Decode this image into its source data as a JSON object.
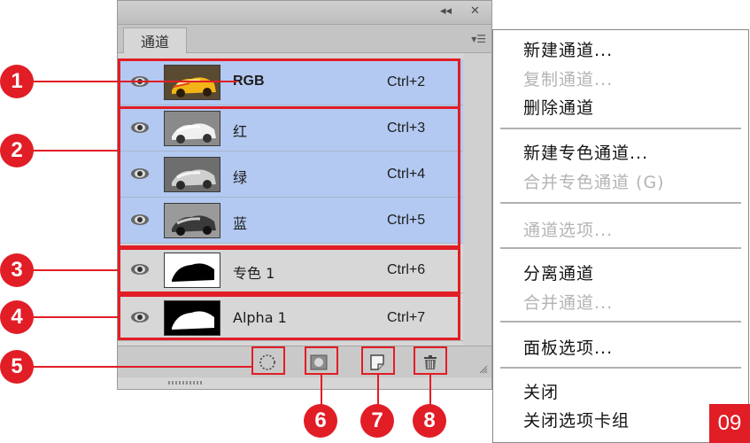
{
  "panel": {
    "titlebar": {
      "collapse_glyph": "◂◂",
      "close_glyph": "✕"
    },
    "tab_label": "通道",
    "menu_glyph": "▾☰",
    "channels": [
      {
        "name": "RGB",
        "shortcut": "Ctrl+2",
        "selected": true,
        "visible": true
      },
      {
        "name": "红",
        "shortcut": "Ctrl+3",
        "selected": true,
        "visible": true
      },
      {
        "name": "绿",
        "shortcut": "Ctrl+4",
        "selected": true,
        "visible": true
      },
      {
        "name": "蓝",
        "shortcut": "Ctrl+5",
        "selected": true,
        "visible": true
      },
      {
        "name": "专色 1",
        "shortcut": "Ctrl+6",
        "selected": false,
        "visible": true
      },
      {
        "name": "Alpha 1",
        "shortcut": "Ctrl+7",
        "selected": false,
        "visible": true
      }
    ],
    "bottom_buttons": [
      "load-channel-as-selection",
      "save-selection-as-channel",
      "create-new-channel",
      "delete-channel"
    ]
  },
  "callouts": [
    "1",
    "2",
    "3",
    "4",
    "5",
    "6",
    "7",
    "8"
  ],
  "flyout_menu": {
    "groups": [
      [
        {
          "label": "新建通道...",
          "enabled": true
        },
        {
          "label": "复制通道...",
          "enabled": false
        },
        {
          "label": "删除通道",
          "enabled": true
        }
      ],
      [
        {
          "label": "新建专色通道...",
          "enabled": true
        },
        {
          "label": "合并专色通道 (G)",
          "enabled": false
        }
      ],
      [
        {
          "label": "通道选项...",
          "enabled": false
        }
      ],
      [
        {
          "label": "分离通道",
          "enabled": true
        },
        {
          "label": "合并通道...",
          "enabled": false
        }
      ],
      [
        {
          "label": "面板选项...",
          "enabled": true
        }
      ],
      [
        {
          "label": "关闭",
          "enabled": true
        },
        {
          "label": "关闭选项卡组",
          "enabled": true
        }
      ]
    ]
  },
  "page_number": "09",
  "colors": {
    "accent_red": "#e11d26",
    "selected_row": "#b3c9f1",
    "panel_bg": "#d6d6d6",
    "disabled_text": "#b4b4b4"
  }
}
